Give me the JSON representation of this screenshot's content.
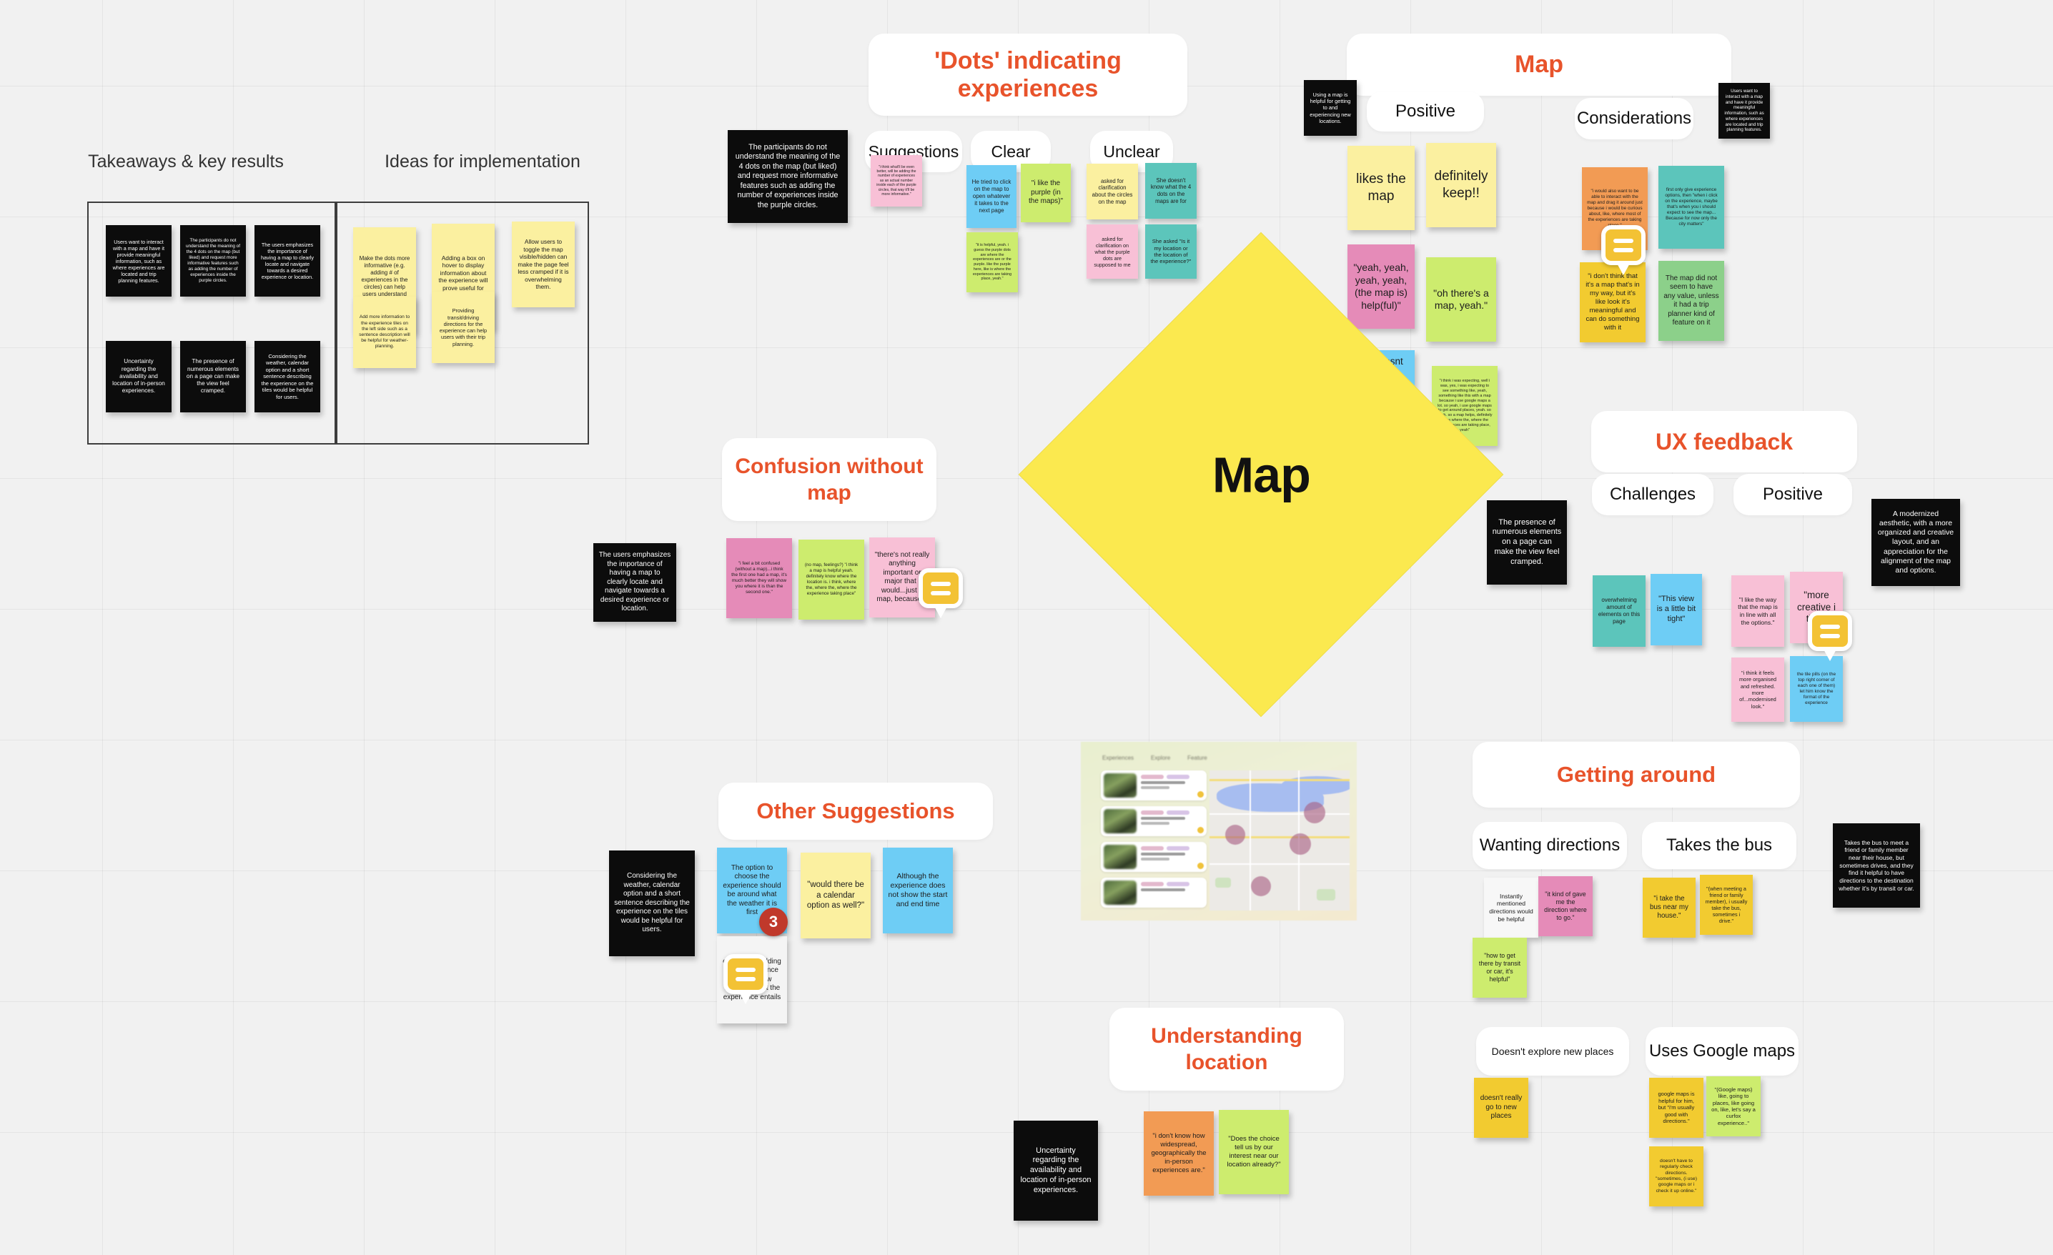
{
  "board": {
    "background_color": "#f1f1f1",
    "accent_color": "#e8532b"
  },
  "takeaways_board": {
    "left_title": "Takeaways & key results",
    "right_title": "Ideas for implementation",
    "takeaway_notes": [
      "Users want to interact with a map and have it provide meaningful information, such as where experiences are located and trip planning features.",
      "The participants do not understand the meaning of the 4 dots on the map (but liked) and request more informative features such as adding the number of experiences inside the purple circles.",
      "The users emphasizes the importance of having a map to clearly locate and navigate towards a desired experience or location.",
      "Uncertainty regarding the availability and location of in-person experiences.",
      "The presence of numerous elements on a page can make the view feel cramped.",
      "Considering the weather, calendar option and a short sentence describing the experience on the tiles would be helpful for users."
    ],
    "idea_notes": [
      "Make the dots more informative (e.g. adding # of experiences in the circles) can help users understand their meaning.",
      "Adding a box on hover to display information about the experience will prove useful for users.",
      "Allow users to toggle the map visible/hidden can make the page feel less cramped if it is overwhelming them.",
      "Add more information to the experience tiles on the left side such as a sentence description will be helpful for weather-planning.",
      "Providing transit/driving directions for the experience can help users with their trip planning."
    ]
  },
  "dots_section": {
    "title": "'Dots' indicating experiences",
    "insight": "The participants do not understand the meaning of the 4 dots on the map (but liked) and request more informative features such as adding the number of experiences inside the purple circles.",
    "columns": [
      {
        "label": "Suggestions",
        "notes": [
          {
            "color": "#f8c0d6",
            "text": "\"i think what'll be even better, will be adding the number of experiences as an actual number inside each of the purple circles, that way it'll be more informative.\""
          }
        ]
      },
      {
        "label": "Clear",
        "notes": [
          {
            "color": "#6ecdf5",
            "text": "He tried to click on the map to open whatever it takes to the next page"
          },
          {
            "color": "#cdec6e",
            "text": "\"i like the purple (in the  maps)\""
          },
          {
            "color": "#cdec6e",
            "text": "\"it is helpful, yeah. i guess the purple dots are where the experiences are or the purple. like the purple here, like is where the experiences are taking place, yeah.\""
          }
        ]
      },
      {
        "label": "Unclear",
        "notes": [
          {
            "color": "#fbf0a0",
            "text": "asked for clarification about the circles on the map"
          },
          {
            "color": "#5cc5bb",
            "text": "She doesn't know what the 4 dots on the maps are for"
          },
          {
            "color": "#f8c0d6",
            "text": "asked for clarification on what the purple dots are supposed to me"
          },
          {
            "color": "#5cc5bb",
            "text": "She asked \"Is it my location or the location of the experience?\""
          }
        ]
      }
    ]
  },
  "map_section": {
    "title": "Map",
    "left_insight": "Using a map is helpful for getting to and experiencing new locations.",
    "right_insight": "Users want to interact with a map and have it provide meaningful information, such as where experiences are located and trip planning features.",
    "columns": [
      {
        "label": "Positive",
        "notes": [
          {
            "color": "#fbf0a0",
            "text": "likes the map",
            "size": "large"
          },
          {
            "color": "#fbf0a0",
            "text": "definitely keep!!",
            "size": "large"
          },
          {
            "color": "#e58bb8",
            "text": "\"yeah, yeah, yeah, yeah, (the map is) help(ful)\"",
            "size": "large"
          },
          {
            "color": "#cdec6e",
            "text": "\"oh there's a map, yeah.\"",
            "size": "large"
          },
          {
            "color": "#6ecdf5",
            "text": "He doesnt use maps, but he uses google maps to get to the location",
            "size": "large"
          },
          {
            "color": "#cdec6e",
            "text": "\"i think i was expecting, well i was, yes, i was expecting to see something like, yeah, something like this with a map because i use google maps a lot. so yeah, i use google maps to get around places, yeah. so yeah. so a map helps, definitely helps where the, where the experiences are taking place, yeah\"",
            "size": "small"
          }
        ]
      },
      {
        "label": "Considerations",
        "notes": [
          {
            "color": "#f29b54",
            "text": "\"i would also want to be able to interact with the map and drag it around just because i would be curious about, like, where most of the experiences are taking place.\"",
            "size": "small"
          },
          {
            "color": "#5cc5bb",
            "text": "first only give experience options, then \"when i click on the experience, maybe that's when you i should expect to see the map... Because for now only the city matters\"",
            "size": "small"
          },
          {
            "color": "#f2cb30",
            "text": "\"i don't think that it's a map that's in my way, but it's like look it's meaningful and can do something with it",
            "size": "large"
          },
          {
            "color": "#8cd08a",
            "text": "The map did not seem to have any value, unless it had a trip planner kind of feature on it",
            "size": "large"
          }
        ]
      }
    ]
  },
  "ux_feedback_section": {
    "title": "UX feedback",
    "left_insight": "The presence of numerous elements on a page can make the view feel cramped.",
    "right_insight": "A modernized aesthetic, with a more organized and creative layout, and an appreciation for the alignment of the map and options.",
    "columns": [
      {
        "label": "Challenges",
        "notes": [
          {
            "color": "#5cc5bb",
            "text": "overwhelming amount of elements on this page"
          },
          {
            "color": "#6ecdf5",
            "text": "\"This view is a little bit tight\""
          }
        ]
      },
      {
        "label": "Positive",
        "notes": [
          {
            "color": "#f8c0d6",
            "text": "\"I like the way that the map is in line with all the options.\""
          },
          {
            "color": "#f8c0d6",
            "text": "\"more creative i think"
          },
          {
            "color": "#f8c0d6",
            "text": "\"i think it feels more organised and refreshed. more of...modernised look.\""
          },
          {
            "color": "#6ecdf5",
            "text": "the tile pills (on the top right corner of each one of them) let him know the format of the experience"
          }
        ]
      }
    ]
  },
  "confusion_section": {
    "title": "Confusion without map",
    "insight": "The users emphasizes the importance of having a map to clearly locate and navigate towards a desired experience or location.",
    "notes": [
      {
        "color": "#e58bb8",
        "text": "\"i feel a bit confused (without a map)...i think the first one had a map, it's much better they will show you where it is than the second one.\""
      },
      {
        "color": "#cdec6e",
        "text": "(no map, feelings?) \"i think a map is helpful yeah. definitely know where the location is. i think, where the, where the, where the experience taking place\""
      },
      {
        "color": "#f8c0d6",
        "text": "\"there's not really anything important or major that i would...just a map, because..."
      }
    ]
  },
  "other_suggestions_section": {
    "title": "Other Suggestions",
    "insight": "Considering the weather,  calendar option and a short sentence describing the experience on the tiles would be helpful for users.",
    "comment_count": "3",
    "notes": [
      {
        "color": "#6ecdf5",
        "text": "The option to choose the experience should be around what the weather it is first"
      },
      {
        "color": "#fbf0a0",
        "text": "\"would there be a calendar option as well?\""
      },
      {
        "color": "#6ecdf5",
        "text": "Although the experience does not show the start and end time"
      },
      {
        "color": "#f4f4f4",
        "text": "experience adding a short sentence below in few words of what the experience entails"
      }
    ]
  },
  "understanding_location_section": {
    "title": "Understanding location",
    "insight": "Uncertainty regarding the availability and location of in-person experiences.",
    "notes": [
      {
        "color": "#f29b54",
        "text": "\"i don't know how widespread, geographically the in-person experiences are.\""
      },
      {
        "color": "#cdec6e",
        "text": "\"Does the choice tell us by our interest near our location already?\""
      }
    ]
  },
  "getting_around_section": {
    "title": "Getting around",
    "insight": "Takes the bus to meet a friend or family member near their house, but sometimes drives, and they find it helpful to have directions to the destination whether it's by transit or car.",
    "columns": [
      {
        "label": "Wanting directions",
        "notes": [
          {
            "color": "#f7f7f7",
            "text": "Instantly mentioned directions would be helpful"
          },
          {
            "color": "#e58bb8",
            "text": "\"it kind of gave me the direction where to go.\""
          },
          {
            "color": "#cdec6e",
            "text": "\"how to get there by transit or car, it's helpful\""
          }
        ]
      },
      {
        "label": "Takes the bus",
        "notes": [
          {
            "color": "#f2cb30",
            "text": "\"i take the bus near my house.\""
          },
          {
            "color": "#f2cb30",
            "text": "\"(when meeting a friend or family member), i usually take the bus, sometimes i drive.\""
          }
        ]
      }
    ]
  },
  "habits_section": {
    "columns": [
      {
        "label": "Doesn't explore new places",
        "notes": [
          {
            "color": "#f2cb30",
            "text": "doesn't really go to new places"
          }
        ]
      },
      {
        "label": "Uses Google maps",
        "notes": [
          {
            "color": "#f2cb30",
            "text": "google maps is helpful for him, but \"i'm usually good with directions.\""
          },
          {
            "color": "#cdec6e",
            "text": "\"(Google maps) like, going to places, like going on, like, let's say a curfox experience..\""
          },
          {
            "color": "#f2cb30",
            "text": "doesn't have to regularly check directions. \"sometimes, (i use) google maps or i check it up online.\""
          }
        ]
      }
    ]
  },
  "center_shape": {
    "label": "Map"
  }
}
